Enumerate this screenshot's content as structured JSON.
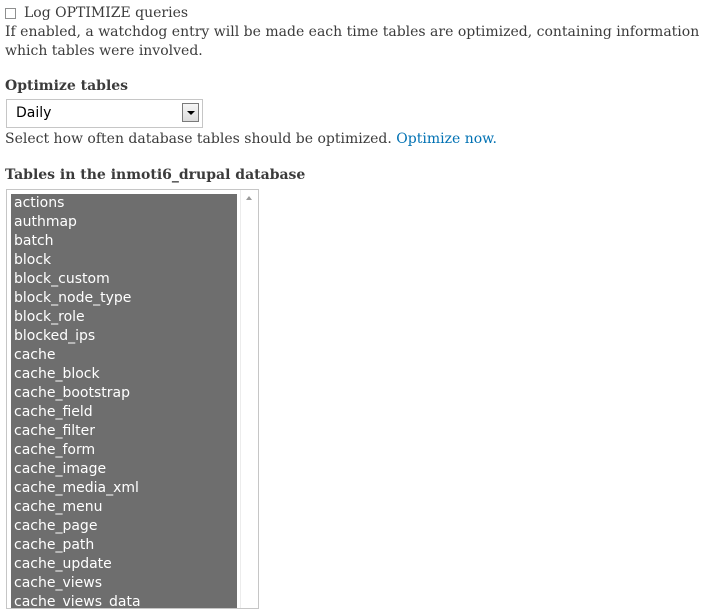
{
  "log": {
    "checkbox_label": "Log OPTIMIZE queries",
    "description": "If enabled, a watchdog entry will be made each time tables are optimized, containing information which tables were involved."
  },
  "optimize": {
    "heading": "Optimize tables",
    "selected": "Daily",
    "description": "Select how often database tables should be optimized.",
    "link_text": "Optimize now."
  },
  "tables": {
    "heading": "Tables in the inmoti6_drupal database",
    "items": [
      "actions",
      "authmap",
      "batch",
      "block",
      "block_custom",
      "block_node_type",
      "block_role",
      "blocked_ips",
      "cache",
      "cache_block",
      "cache_bootstrap",
      "cache_field",
      "cache_filter",
      "cache_form",
      "cache_image",
      "cache_media_xml",
      "cache_menu",
      "cache_page",
      "cache_path",
      "cache_update",
      "cache_views",
      "cache_views_data"
    ]
  },
  "colors": {
    "link": "#0071b3",
    "selected_bg": "#6e6e6e",
    "text": "#3b3b3b"
  }
}
